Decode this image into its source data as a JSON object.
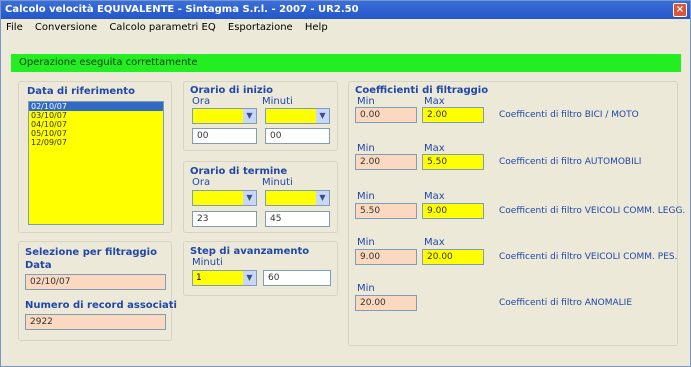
{
  "window": {
    "title": "Calcolo velocità EQUIVALENTE - Sintagma S.r.l. - 2007 - UR2.50",
    "close_glyph": "×"
  },
  "menu": [
    "File",
    "Conversione",
    "Calcolo parametri EQ",
    "Esportazione",
    "Help"
  ],
  "status": "Operazione eseguita correttamente",
  "data_riferimento": {
    "title": "Data di riferimento",
    "items": [
      "02/10/07",
      "03/10/07",
      "04/10/07",
      "05/10/07",
      "12/09/07"
    ],
    "selected_index": 0
  },
  "orario_inizio": {
    "title": "Orario di inizio",
    "ora_label": "Ora",
    "minuti_label": "Minuti",
    "ora_value": "00",
    "minuti_value": "00"
  },
  "orario_termine": {
    "title": "Orario di termine",
    "ora_label": "Ora",
    "minuti_label": "Minuti",
    "ora_value": "23",
    "minuti_value": "45"
  },
  "step": {
    "title": "Step di avanzamento",
    "minuti_label": "Minuti",
    "combo_value": "1",
    "value": "60"
  },
  "selezione": {
    "title": "Selezione per filtraggio",
    "data_label": "Data",
    "data_value": "02/10/07",
    "records_label": "Numero di record associati",
    "records_value": "2922"
  },
  "coefficienti": {
    "title": "Coefficienti di filtraggio",
    "min_label": "Min",
    "max_label": "Max",
    "rows": [
      {
        "min": "0.00",
        "max": "2.00",
        "desc": "Coefficenti di filtro BICI / MOTO"
      },
      {
        "min": "2.00",
        "max": "5.50",
        "desc": "Coefficenti di filtro AUTOMOBILI"
      },
      {
        "min": "5.50",
        "max": "9.00",
        "desc": "Coefficenti di filtro VEICOLI COMM. LEGG."
      },
      {
        "min": "9.00",
        "max": "20.00",
        "desc": "Coefficenti di filtro VEICOLI COMM. PES."
      },
      {
        "min": "20.00",
        "max": "",
        "desc": "Coefficenti di filtro ANOMALIE"
      }
    ]
  },
  "colors": {
    "status_bg": "#22ee22",
    "input_yellow": "#ffff00",
    "input_peach": "#fbd9c0",
    "label_blue": "#2147a8"
  }
}
